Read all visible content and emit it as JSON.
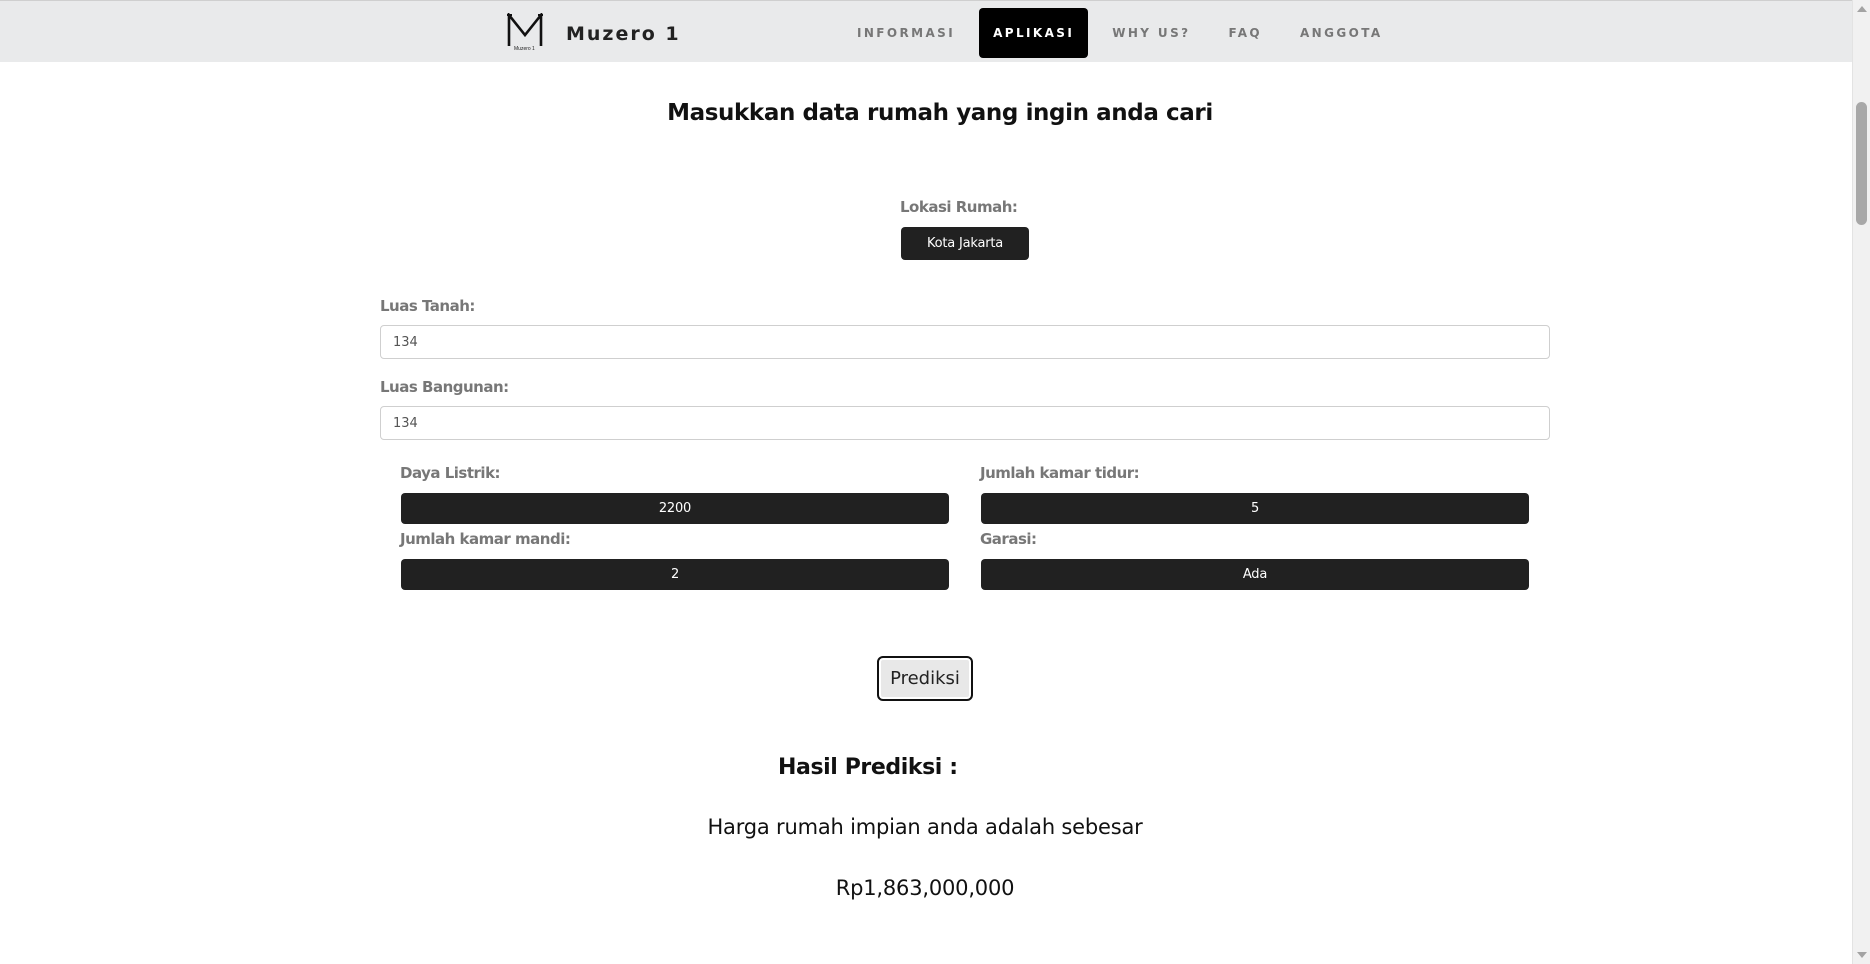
{
  "navbar": {
    "brand_name": "Muzero 1",
    "logo_letter": "M",
    "logo_subtext": "Muzero 1",
    "items": [
      {
        "label": "INFORMASI",
        "active": false
      },
      {
        "label": "APLIKASI",
        "active": true
      },
      {
        "label": "WHY US?",
        "active": false
      },
      {
        "label": "FAQ",
        "active": false
      },
      {
        "label": "ANGGOTA",
        "active": false
      }
    ]
  },
  "form": {
    "title": "Masukkan data rumah yang ingin anda cari",
    "lokasi": {
      "label": "Lokasi Rumah:",
      "value": "Kota Jakarta"
    },
    "luas_tanah": {
      "label": "Luas Tanah:",
      "value": "134"
    },
    "luas_bangunan": {
      "label": "Luas Bangunan:",
      "value": "134"
    },
    "daya_listrik": {
      "label": "Daya Listrik:",
      "value": "2200"
    },
    "kamar_tidur": {
      "label": "Jumlah kamar tidur:",
      "value": "5"
    },
    "kamar_mandi": {
      "label": "Jumlah kamar mandi:",
      "value": "2"
    },
    "garasi": {
      "label": "Garasi:",
      "value": "Ada"
    },
    "submit_label": "Prediksi"
  },
  "result": {
    "heading": "Hasil Prediksi :",
    "text": "Harga rumah impian anda adalah sebesar",
    "price": "Rp1,863,000,000"
  },
  "colors": {
    "navbar_bg": "#e9eaeb",
    "active_nav_bg": "#000000",
    "select_bg": "#212121",
    "label_color": "#777777"
  }
}
